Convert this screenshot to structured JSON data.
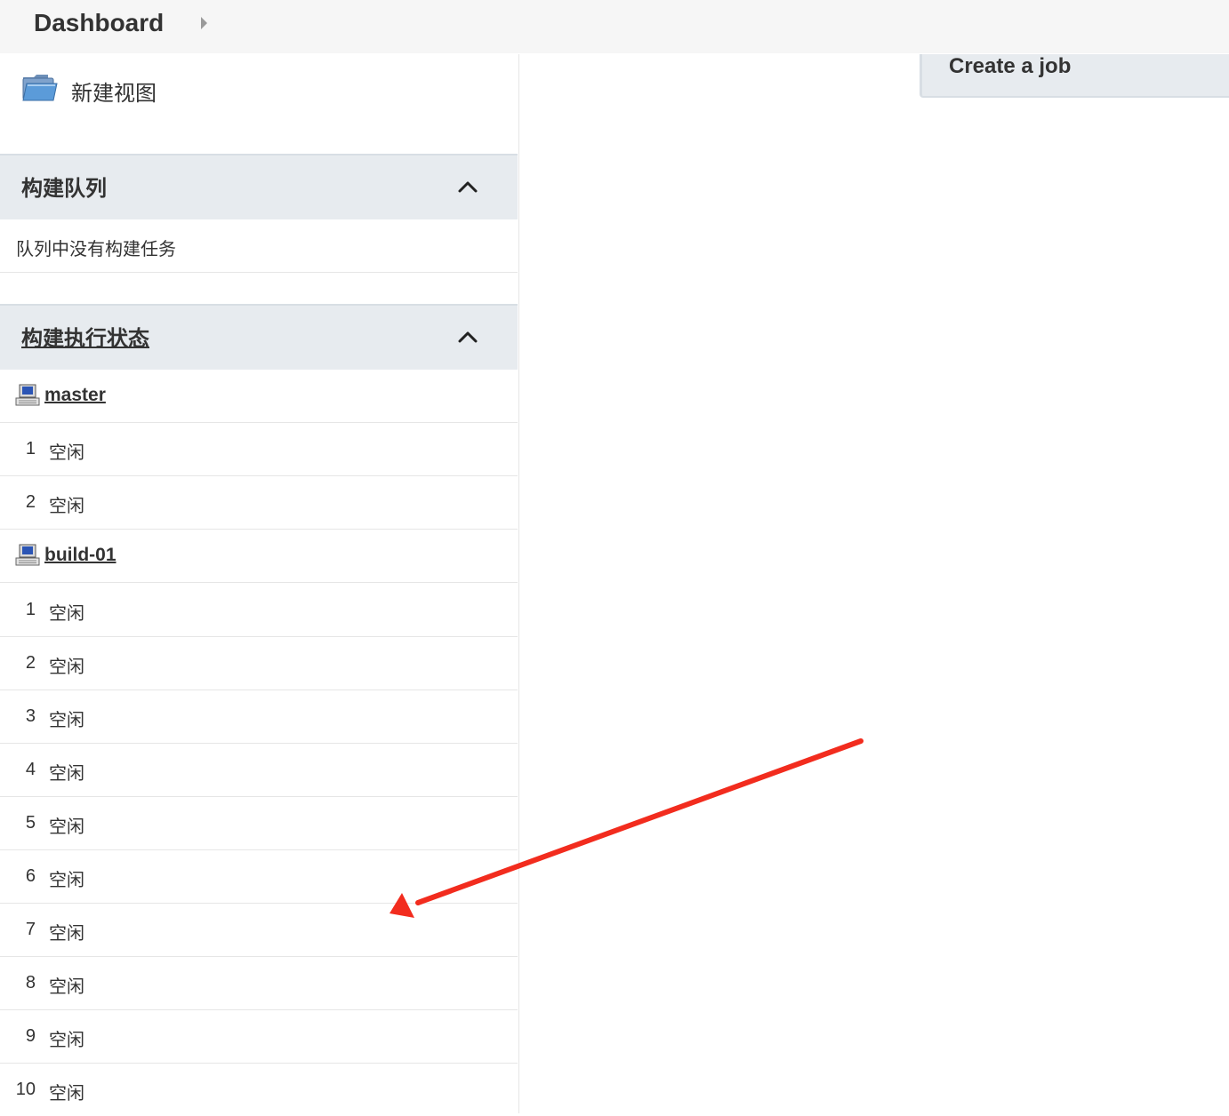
{
  "header": {
    "breadcrumb_title": "Dashboard"
  },
  "sidebar": {
    "new_view_label": "新建视图",
    "build_queue": {
      "title": "构建队列",
      "empty_text": "队列中没有构建任务"
    },
    "executor_status": {
      "title": "构建执行状态",
      "nodes": [
        {
          "name": "master",
          "executors": [
            {
              "num": "1",
              "status": "空闲"
            },
            {
              "num": "2",
              "status": "空闲"
            }
          ]
        },
        {
          "name": "build-01",
          "executors": [
            {
              "num": "1",
              "status": "空闲"
            },
            {
              "num": "2",
              "status": "空闲"
            },
            {
              "num": "3",
              "status": "空闲"
            },
            {
              "num": "4",
              "status": "空闲"
            },
            {
              "num": "5",
              "status": "空闲"
            },
            {
              "num": "6",
              "status": "空闲"
            },
            {
              "num": "7",
              "status": "空闲"
            },
            {
              "num": "8",
              "status": "空闲"
            },
            {
              "num": "9",
              "status": "空闲"
            },
            {
              "num": "10",
              "status": "空闲"
            }
          ]
        }
      ]
    }
  },
  "main": {
    "create_job_label": "Create a job"
  },
  "annotation": {
    "arrow_color": "#f22c1e"
  }
}
